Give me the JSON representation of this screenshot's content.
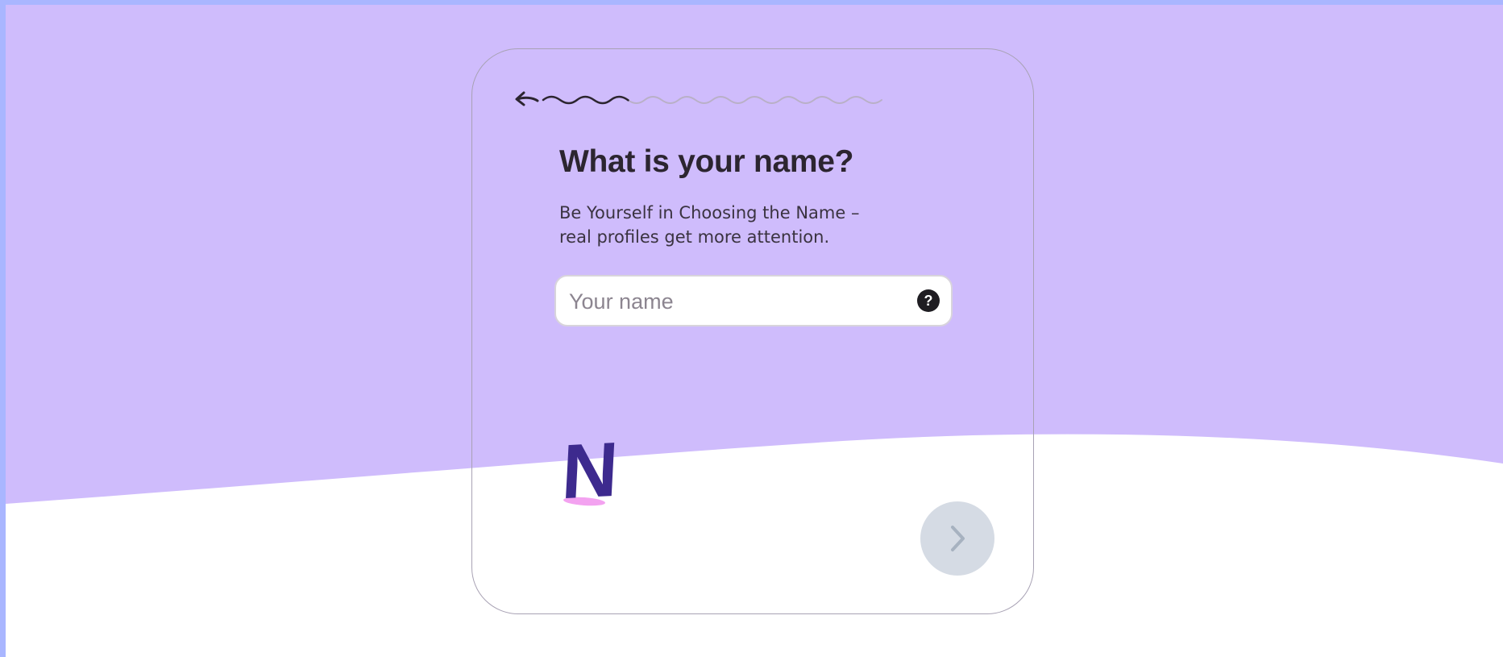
{
  "colors": {
    "background_lavender": "#cfbcfc",
    "frame_blue": "#a9b6ff",
    "text_dark": "#2c2530",
    "logo_purple": "#3d2a8e",
    "logo_pink": "#f3a2f0",
    "next_button_disabled": "#d5dbe4"
  },
  "header": {
    "back_icon": "back-arrow-icon",
    "progress": {
      "completed_fraction": 0.25
    }
  },
  "form": {
    "title": "What is your name?",
    "subtitle_line1": "Be Yourself in Choosing the Name –",
    "subtitle_line2": "real profiles get more attention.",
    "name_input": {
      "placeholder": "Your name",
      "value": ""
    },
    "help_icon_glyph": "?"
  },
  "footer": {
    "logo_letter": "N",
    "next_icon": "chevron-right-icon",
    "next_enabled": false
  }
}
